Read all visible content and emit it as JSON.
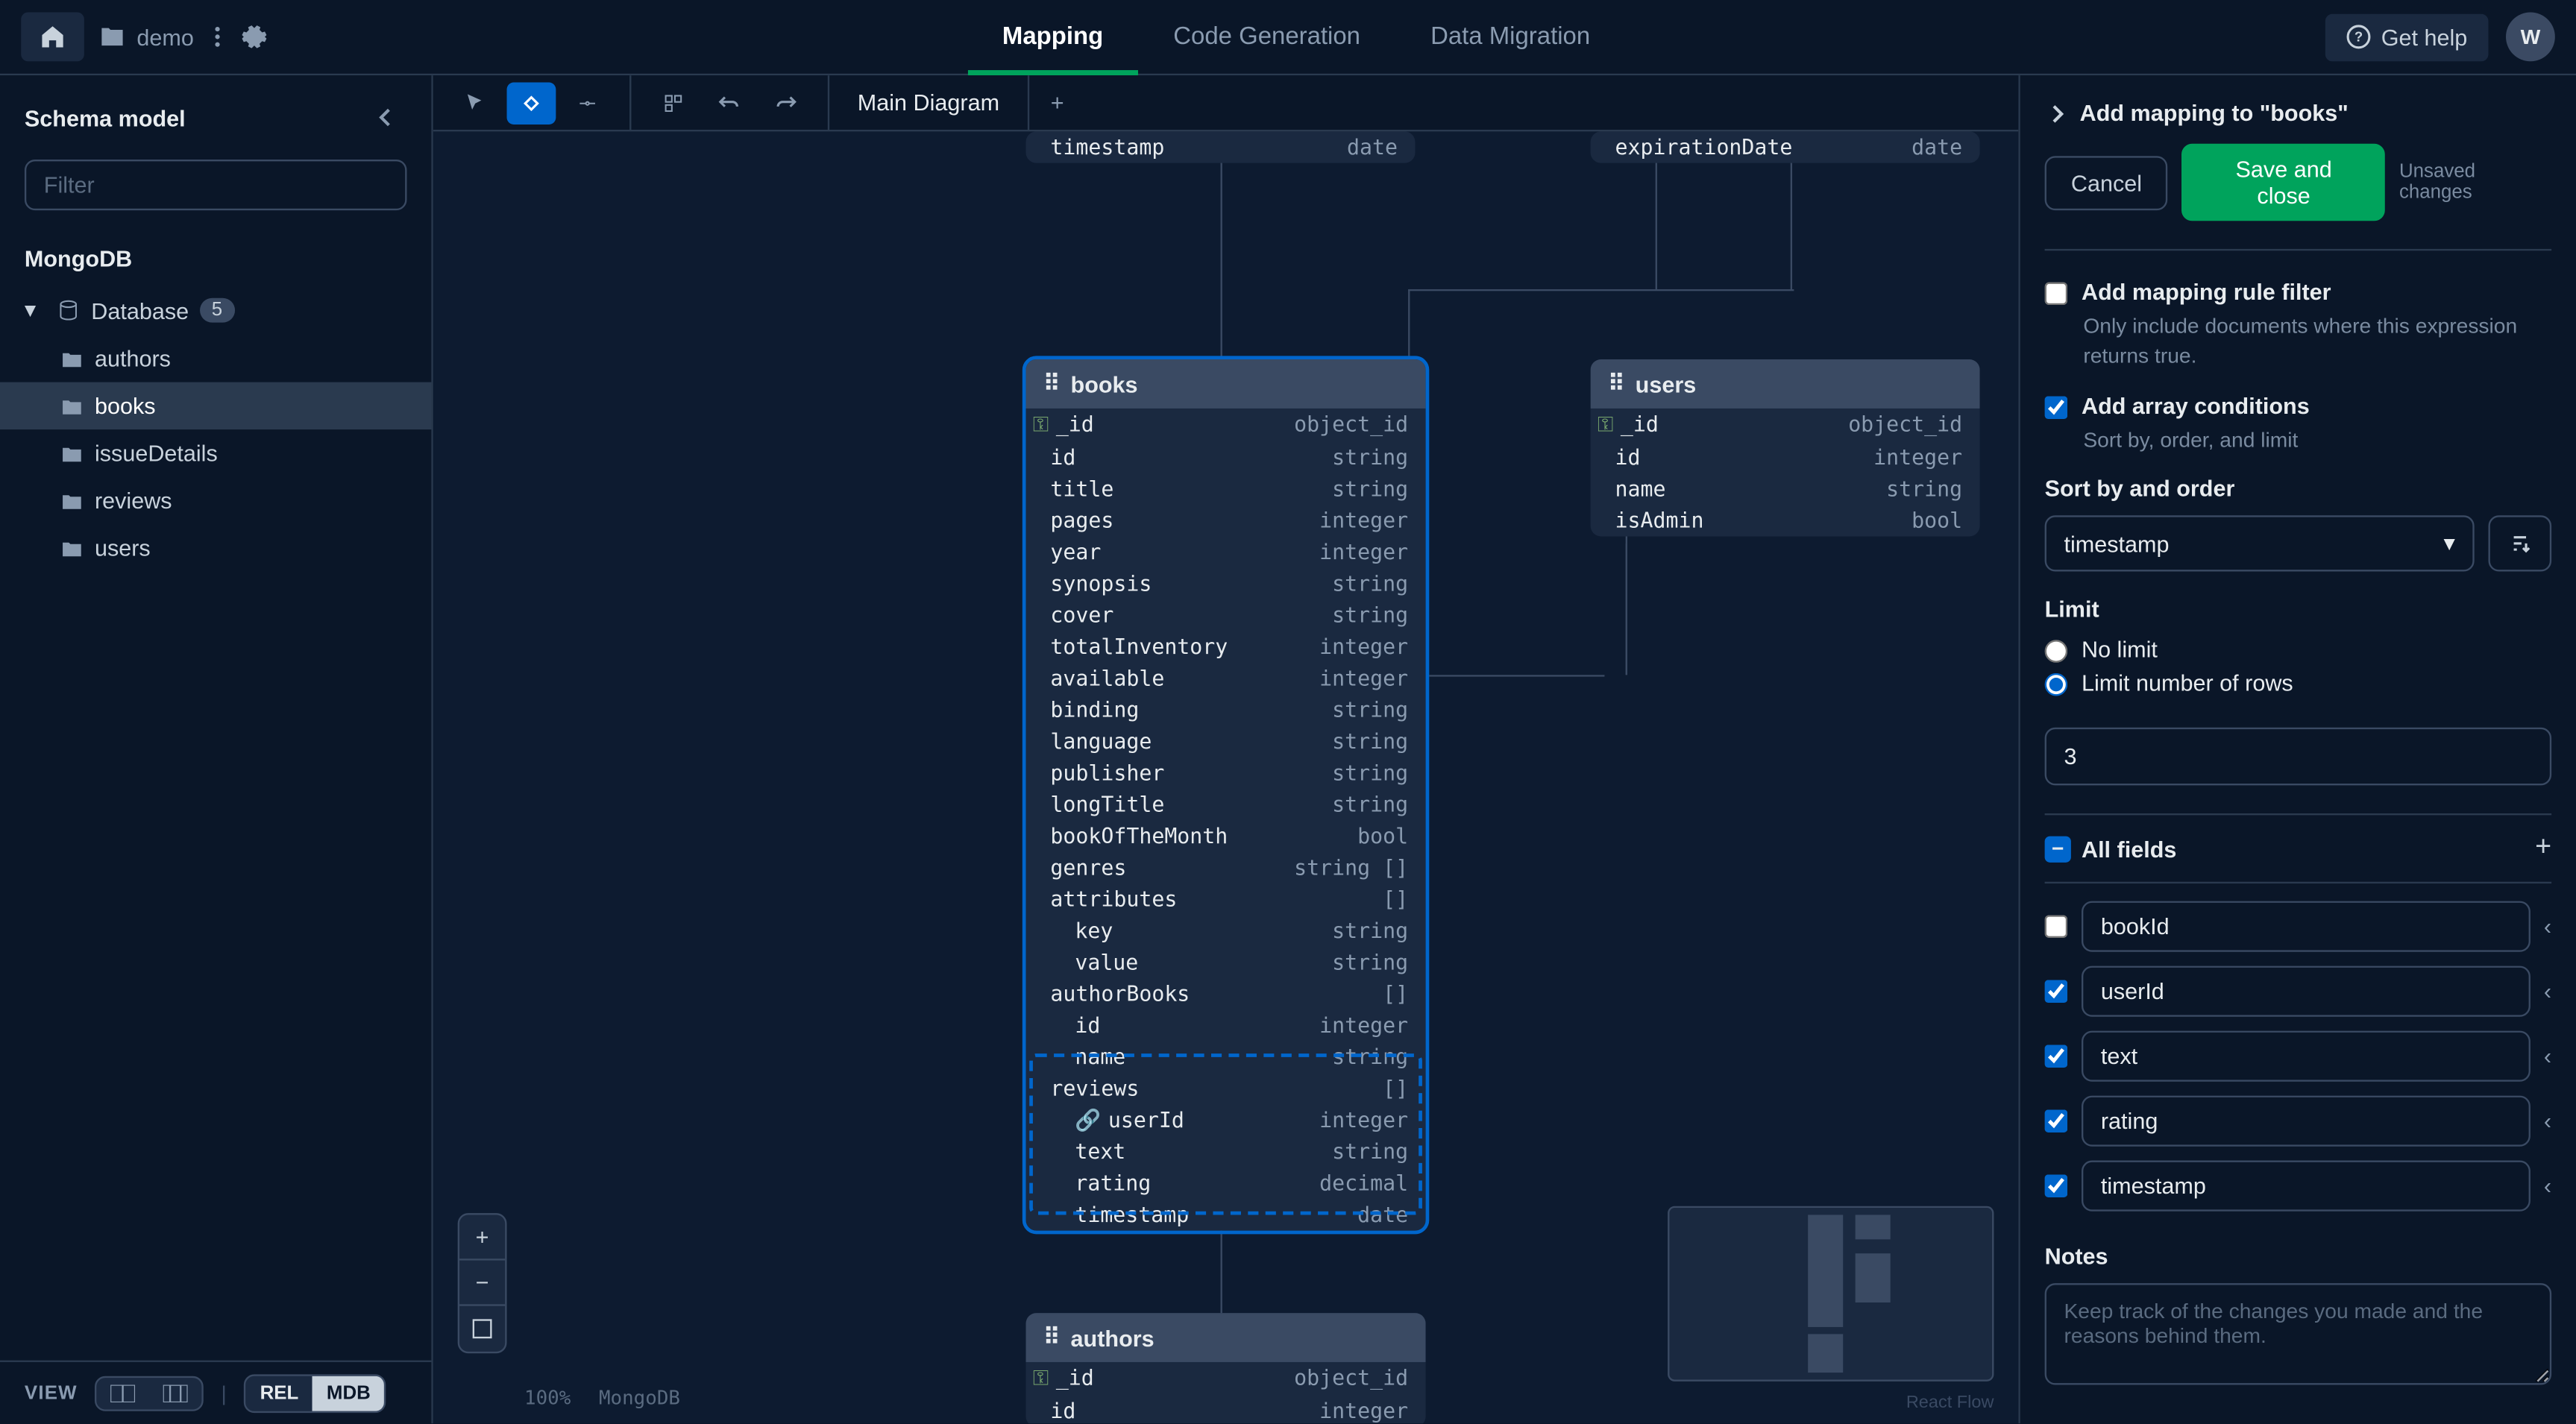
{
  "topbar": {
    "project_name": "demo",
    "tabs": [
      "Mapping",
      "Code Generation",
      "Data Migration"
    ],
    "active_tab_index": 0,
    "get_help": "Get help",
    "avatar_initial": "W"
  },
  "sidebar": {
    "title": "Schema model",
    "filter_placeholder": "Filter",
    "db_label": "MongoDB",
    "database_label": "Database",
    "database_count": "5",
    "collections": [
      "authors",
      "books",
      "issueDetails",
      "reviews",
      "users"
    ],
    "active_collection_index": 1
  },
  "viewbar": {
    "label": "VIEW",
    "rel": "REL",
    "mdb": "MDB"
  },
  "canvas": {
    "diagram_tab": "Main Diagram",
    "zoom": "100%",
    "engine": "MongoDB",
    "react_flow": "React Flow",
    "truncated_header_row": {
      "name": "timestamp",
      "type": "date"
    },
    "truncated_header_row2": {
      "name": "expirationDate",
      "type": "date"
    },
    "books": {
      "title": "books",
      "rows": [
        {
          "name": "_id",
          "type": "object_id",
          "key": true
        },
        {
          "name": "id",
          "type": "string"
        },
        {
          "name": "title",
          "type": "string"
        },
        {
          "name": "pages",
          "type": "integer"
        },
        {
          "name": "year",
          "type": "integer"
        },
        {
          "name": "synopsis",
          "type": "string"
        },
        {
          "name": "cover",
          "type": "string"
        },
        {
          "name": "totalInventory",
          "type": "integer"
        },
        {
          "name": "available",
          "type": "integer"
        },
        {
          "name": "binding",
          "type": "string"
        },
        {
          "name": "language",
          "type": "string"
        },
        {
          "name": "publisher",
          "type": "string"
        },
        {
          "name": "longTitle",
          "type": "string"
        },
        {
          "name": "bookOfTheMonth",
          "type": "bool"
        },
        {
          "name": "genres",
          "type": "string []"
        },
        {
          "name": "attributes",
          "type": "[]"
        },
        {
          "name": "key",
          "type": "string",
          "indent": true
        },
        {
          "name": "value",
          "type": "string",
          "indent": true
        },
        {
          "name": "authorBooks",
          "type": "[]"
        },
        {
          "name": "id",
          "type": "integer",
          "indent": true
        },
        {
          "name": "name",
          "type": "string",
          "indent": true
        },
        {
          "name": "reviews",
          "type": "[]"
        },
        {
          "name": "userId",
          "type": "integer",
          "indent": true,
          "link": true
        },
        {
          "name": "text",
          "type": "string",
          "indent": true
        },
        {
          "name": "rating",
          "type": "decimal",
          "indent": true
        },
        {
          "name": "timestamp",
          "type": "date",
          "indent": true
        }
      ]
    },
    "users": {
      "title": "users",
      "rows": [
        {
          "name": "_id",
          "type": "object_id",
          "key": true
        },
        {
          "name": "id",
          "type": "integer"
        },
        {
          "name": "name",
          "type": "string"
        },
        {
          "name": "isAdmin",
          "type": "bool"
        }
      ]
    },
    "authors": {
      "title": "authors",
      "rows": [
        {
          "name": "_id",
          "type": "object_id",
          "key": true
        },
        {
          "name": "id",
          "type": "integer"
        }
      ]
    }
  },
  "right_panel": {
    "title": "Add mapping to \"books\"",
    "cancel": "Cancel",
    "save": "Save and close",
    "unsaved": "Unsaved changes",
    "filter_label": "Add mapping rule filter",
    "filter_desc": "Only include documents where this expression returns true.",
    "array_label": "Add array conditions",
    "array_desc": "Sort by, order, and limit",
    "sort_label": "Sort by and order",
    "sort_value": "timestamp",
    "limit_label": "Limit",
    "no_limit": "No limit",
    "limit_rows": "Limit number of rows",
    "limit_value": "3",
    "all_fields": "All fields",
    "fields": [
      {
        "name": "bookId",
        "checked": false
      },
      {
        "name": "userId",
        "checked": true
      },
      {
        "name": "text",
        "checked": true
      },
      {
        "name": "rating",
        "checked": true
      },
      {
        "name": "timestamp",
        "checked": true
      }
    ],
    "notes_label": "Notes",
    "notes_placeholder": "Keep track of the changes you made and the reasons behind them."
  }
}
